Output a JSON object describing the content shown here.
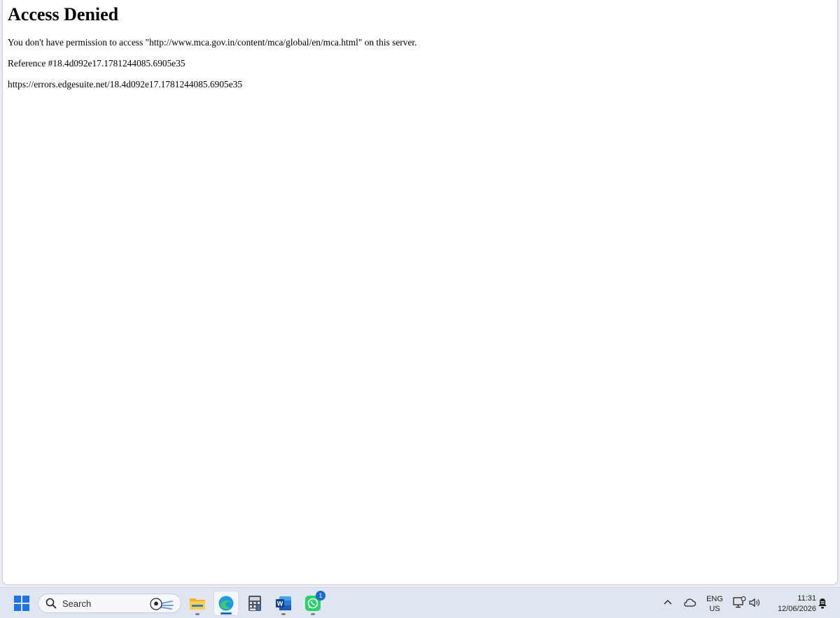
{
  "page": {
    "heading": "Access Denied",
    "message": "You don't have permission to access \"http://www.mca.gov.in/content/mca/global/en/mca.html\" on this server.",
    "reference": "Reference #18.4d092e17.1781244085.6905e35",
    "error_url": "https://errors.edgesuite.net/18.4d092e17.1781244085.6905e35"
  },
  "taskbar": {
    "search_label": "Search",
    "apps": [
      {
        "name": "file-explorer",
        "icon": "folder-icon"
      },
      {
        "name": "edge",
        "icon": "edge-icon",
        "active": true
      },
      {
        "name": "calculator",
        "icon": "calculator-icon"
      },
      {
        "name": "word",
        "icon": "word-icon"
      },
      {
        "name": "whatsapp",
        "icon": "whatsapp-icon",
        "badge": "1"
      }
    ],
    "tray": {
      "lang_line1": "ENG",
      "lang_line2": "US",
      "time": "11:31",
      "date": "12/06/2026"
    }
  },
  "colors": {
    "accent": "#1a6ad6",
    "taskbar_bg": "#dfe6f0",
    "whatsapp": "#25d366"
  }
}
